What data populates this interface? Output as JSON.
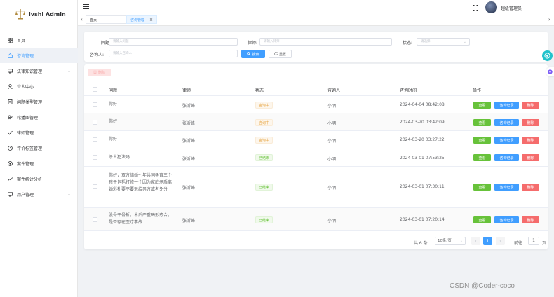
{
  "app": {
    "title": "lvshi Admin"
  },
  "sidebar": {
    "items": [
      {
        "label": "首页",
        "icon": "grid-icon"
      },
      {
        "label": "咨询管理",
        "icon": "home-icon",
        "active": true
      },
      {
        "label": "法律知识管理",
        "icon": "monitor-icon",
        "has_children": true
      },
      {
        "label": "个人中心",
        "icon": "user-icon"
      },
      {
        "label": "问题类型管理",
        "icon": "document-icon"
      },
      {
        "label": "轮播图管理",
        "icon": "users-icon"
      },
      {
        "label": "律师管理",
        "icon": "check-icon"
      },
      {
        "label": "评价标签管理",
        "icon": "clock-icon"
      },
      {
        "label": "案件管理",
        "icon": "target-icon"
      },
      {
        "label": "案件统计分析",
        "icon": "chart-icon"
      },
      {
        "label": "用户管理",
        "icon": "monitor-icon",
        "has_children": true
      }
    ]
  },
  "header": {
    "user_name": "超级管理员"
  },
  "tabs": [
    {
      "label": "首页"
    },
    {
      "label": "咨询管理",
      "active": true,
      "close": "×"
    }
  ],
  "search": {
    "question_label": "问题:",
    "question_placeholder": "请输入问题",
    "lawyer_label": "律师:",
    "lawyer_placeholder": "请输入律师",
    "status_label": "状态:",
    "status_placeholder": "请选择",
    "consultant_label": "咨询人:",
    "consultant_placeholder": "请输入咨询人",
    "search_button": "搜索",
    "reset_button": "重置"
  },
  "table": {
    "batch_delete": "删除",
    "columns": [
      "问题",
      "律师",
      "状态",
      "咨询人",
      "咨询时间",
      "操作"
    ],
    "rows": [
      {
        "question": "你好",
        "lawyer": "张沂峰",
        "status": "咨询中",
        "status_type": "warn",
        "consultant": "小明",
        "time": "2024-04-04 08:42:08"
      },
      {
        "question": "你好",
        "lawyer": "张沂峰",
        "status": "咨询中",
        "status_type": "warn",
        "consultant": "小明",
        "time": "2024-03-20 03:42:09"
      },
      {
        "question": "你好",
        "lawyer": "张沂峰",
        "status": "咨询中",
        "status_type": "warn",
        "consultant": "小明",
        "time": "2024-03-20 03:27:22"
      },
      {
        "question": "杀人犯法吗",
        "lawyer": "张沂峰",
        "status": "已结束",
        "status_type": "ok",
        "consultant": "小明",
        "time": "2024-03-01 07:53:25"
      },
      {
        "question": "你好，双方结婚七年共同孕育三个孩子包括打修一个因为家庭矛盾离婚彩礼要不要退给男方或者免分",
        "lawyer": "张沂峰",
        "status": "已结束",
        "status_type": "ok",
        "consultant": "小明",
        "time": "2024-03-01 07:30:11"
      },
      {
        "question": "股骨干骨折，术后严重畸形愈合，是否存在医疗事故",
        "lawyer": "张沂峰",
        "status": "已结束",
        "status_type": "ok",
        "consultant": "小明",
        "time": "2024-03-01 07:20:14"
      }
    ],
    "actions": {
      "view": "查看",
      "records": "咨询记录",
      "delete": "删除"
    }
  },
  "pagination": {
    "total": "共 6 条",
    "page_size": "10条/页",
    "prev": "‹",
    "next": "›",
    "current": "1",
    "goto_label": "前往",
    "goto_value": "1",
    "page_suffix": "页"
  },
  "watermark": "CSDN @Coder-coco",
  "colors": {
    "primary": "#409eff",
    "success": "#67c23a",
    "danger": "#f56c6c",
    "warning": "#e6a23c"
  }
}
